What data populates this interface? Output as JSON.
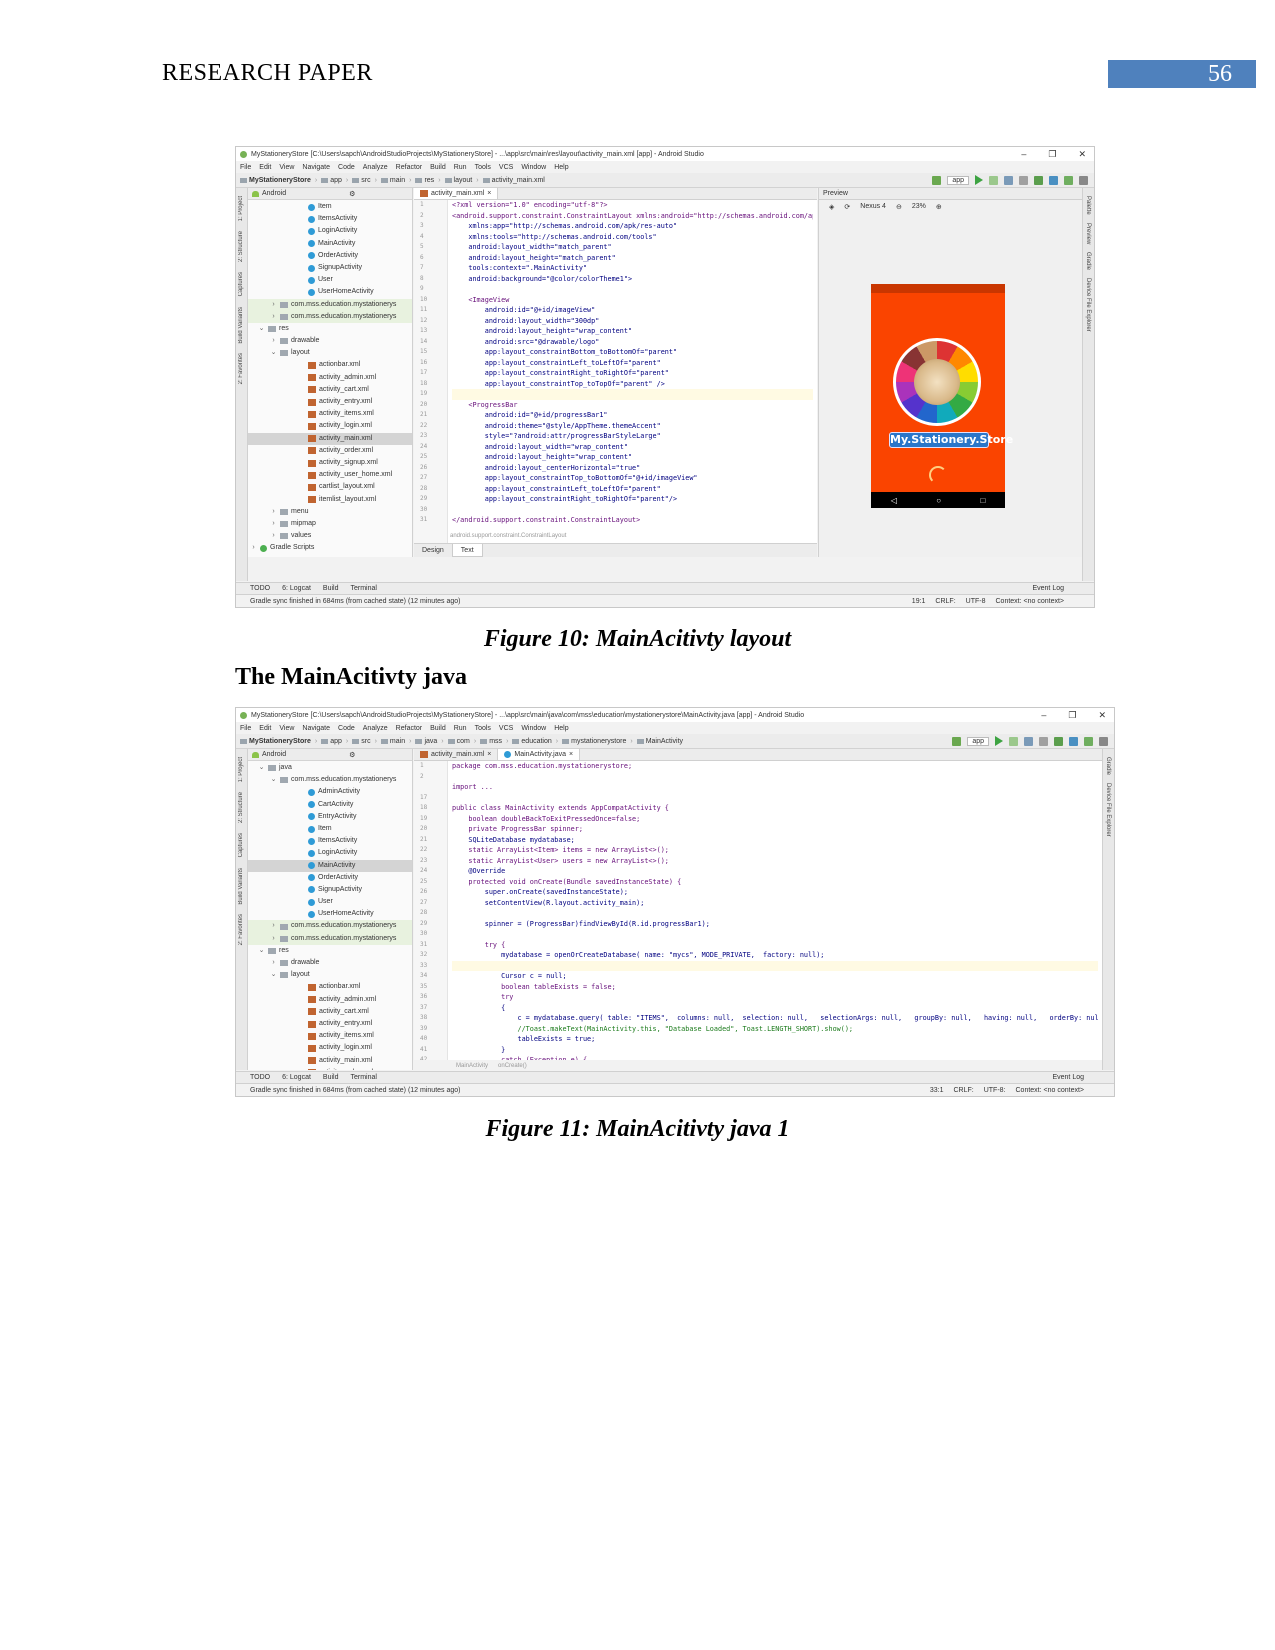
{
  "header": {
    "running_head": "RESEARCH PAPER",
    "page_number": "56"
  },
  "figure10": {
    "title": "MyStationeryStore [C:\\Users\\sapch\\AndroidStudioProjects\\MyStationeryStore] - ...\\app\\src\\main\\res\\layout\\activity_main.xml [app] - Android Studio",
    "menu": [
      "File",
      "Edit",
      "View",
      "Navigate",
      "Code",
      "Analyze",
      "Refactor",
      "Build",
      "Run",
      "Tools",
      "VCS",
      "Window",
      "Help"
    ],
    "breadcrumbs": [
      "MyStationeryStore",
      "app",
      "src",
      "main",
      "res",
      "layout",
      "activity_main.xml"
    ],
    "run_config": "app",
    "pane_mode": "Android",
    "tab": "activity_main.xml",
    "preview_label": "Preview",
    "device": "Nexus 4",
    "zoom": "23%",
    "left_strip": [
      "1: Project",
      "2: Structure",
      "Captures",
      "Build Variants",
      "2: Favorites"
    ],
    "right_strip": [
      "Palette",
      "Preview",
      "Gradle",
      "Device File Explorer"
    ],
    "tree": [
      {
        "label": "Item",
        "kind": "class"
      },
      {
        "label": "ItemsActivity",
        "kind": "class"
      },
      {
        "label": "LoginActivity",
        "kind": "class"
      },
      {
        "label": "MainActivity",
        "kind": "class"
      },
      {
        "label": "OrderActivity",
        "kind": "class"
      },
      {
        "label": "SignupActivity",
        "kind": "class"
      },
      {
        "label": "User",
        "kind": "class"
      },
      {
        "label": "UserHomeActivity",
        "kind": "class"
      },
      {
        "label": "com.mss.education.mystationerys",
        "kind": "pkg"
      },
      {
        "label": "com.mss.education.mystationerys",
        "kind": "pkg"
      },
      {
        "label": "res",
        "kind": "dir"
      },
      {
        "label": "drawable",
        "kind": "dir"
      },
      {
        "label": "layout",
        "kind": "dir"
      },
      {
        "label": "actionbar.xml",
        "kind": "xml"
      },
      {
        "label": "activity_admin.xml",
        "kind": "xml"
      },
      {
        "label": "activity_cart.xml",
        "kind": "xml"
      },
      {
        "label": "activity_entry.xml",
        "kind": "xml"
      },
      {
        "label": "activity_items.xml",
        "kind": "xml"
      },
      {
        "label": "activity_login.xml",
        "kind": "xml"
      },
      {
        "label": "activity_main.xml",
        "kind": "xml"
      },
      {
        "label": "activity_order.xml",
        "kind": "xml"
      },
      {
        "label": "activity_signup.xml",
        "kind": "xml"
      },
      {
        "label": "activity_user_home.xml",
        "kind": "xml"
      },
      {
        "label": "cartlist_layout.xml",
        "kind": "xml"
      },
      {
        "label": "itemlist_layout.xml",
        "kind": "xml"
      },
      {
        "label": "menu",
        "kind": "dir"
      },
      {
        "label": "mipmap",
        "kind": "dir"
      },
      {
        "label": "values",
        "kind": "dir"
      },
      {
        "label": "Gradle Scripts",
        "kind": "gradle"
      }
    ],
    "line_numbers": [
      "1",
      "2",
      "3",
      "4",
      "5",
      "6",
      "7",
      "8",
      "9",
      "10",
      "11",
      "12",
      "13",
      "14",
      "15",
      "16",
      "17",
      "18",
      "19",
      "20",
      "21",
      "22",
      "23",
      "24",
      "25",
      "26",
      "27",
      "28",
      "29",
      "30",
      "31"
    ],
    "code": [
      "<?xml version=\"1.0\" encoding=\"utf-8\"?>",
      "<android.support.constraint.ConstraintLayout xmlns:android=\"http://schemas.android.com/ap",
      "    xmlns:app=\"http://schemas.android.com/apk/res-auto\"",
      "    xmlns:tools=\"http://schemas.android.com/tools\"",
      "    android:layout_width=\"match_parent\"",
      "    android:layout_height=\"match_parent\"",
      "    tools:context=\".MainActivity\"",
      "    android:background=\"@color/colorTheme1\">",
      "",
      "    <ImageView",
      "        android:id=\"@+id/imageView\"",
      "        android:layout_width=\"300dp\"",
      "        android:layout_height=\"wrap_content\"",
      "        android:src=\"@drawable/logo\"",
      "        app:layout_constraintBottom_toBottomOf=\"parent\"",
      "        app:layout_constraintLeft_toLeftOf=\"parent\"",
      "        app:layout_constraintRight_toRightOf=\"parent\"",
      "        app:layout_constraintTop_toTopOf=\"parent\" />",
      "",
      "    <ProgressBar",
      "        android:id=\"@+id/progressBar1\"",
      "        android:theme=\"@style/AppTheme.themeAccent\"",
      "        style=\"?android:attr/progressBarStyleLarge\"",
      "        android:layout_width=\"wrap_content\"",
      "        android:layout_height=\"wrap_content\"",
      "        android:layout_centerHorizontal=\"true\"",
      "        app:layout_constraintTop_toBottomOf=\"@+id/imageView\"",
      "        app:layout_constraintLeft_toLeftOf=\"parent\"",
      "        app:layout_constraintRight_toRightOf=\"parent\"/>",
      "",
      "</android.support.constraint.ConstraintLayout>"
    ],
    "code_breadcrumb": "android.support.constraint.ConstraintLayout",
    "design_tab": "Design",
    "text_tab": "Text",
    "phone_banner": "My.Stationery.Store",
    "bottom_tools": [
      "TODO",
      "6: Logcat",
      "Build",
      "Terminal"
    ],
    "event_log": "Event Log",
    "status": "Gradle sync finished in 684ms (from cached state) (12 minutes ago)",
    "status_right": [
      "19:1",
      "CRLF:",
      "UTF-8",
      "Context: <no context>"
    ],
    "caption": "Figure 10: MainAcitivty layout"
  },
  "section_heading": "The MainAcitivty java",
  "figure11": {
    "title": "MyStationeryStore [C:\\Users\\sapch\\AndroidStudioProjects\\MyStationeryStore] - ...\\app\\src\\main\\java\\com\\mss\\education\\mystationerystore\\MainActivity.java [app] - Android Studio",
    "menu": [
      "File",
      "Edit",
      "View",
      "Navigate",
      "Code",
      "Analyze",
      "Refactor",
      "Build",
      "Run",
      "Tools",
      "VCS",
      "Window",
      "Help"
    ],
    "breadcrumbs": [
      "MyStationeryStore",
      "app",
      "src",
      "main",
      "java",
      "com",
      "mss",
      "education",
      "mystationerystore",
      "MainActivity"
    ],
    "run_config": "app",
    "pane_mode": "Android",
    "tabs": [
      "activity_main.xml",
      "MainActivity.java"
    ],
    "left_strip": [
      "1: Project",
      "2: Structure",
      "Captures",
      "Build Variants",
      "2: Favorites"
    ],
    "right_strip": [
      "Gradle",
      "Device File Explorer"
    ],
    "tree": [
      {
        "label": "java",
        "kind": "dir"
      },
      {
        "label": "com.mss.education.mystationerys",
        "kind": "pkgdir"
      },
      {
        "label": "AdminActivity",
        "kind": "class"
      },
      {
        "label": "CartActivity",
        "kind": "class"
      },
      {
        "label": "EntryActivity",
        "kind": "class"
      },
      {
        "label": "Item",
        "kind": "class"
      },
      {
        "label": "ItemsActivity",
        "kind": "class"
      },
      {
        "label": "LoginActivity",
        "kind": "class"
      },
      {
        "label": "MainActivity",
        "kind": "class"
      },
      {
        "label": "OrderActivity",
        "kind": "class"
      },
      {
        "label": "SignupActivity",
        "kind": "class"
      },
      {
        "label": "User",
        "kind": "class"
      },
      {
        "label": "UserHomeActivity",
        "kind": "class"
      },
      {
        "label": "com.mss.education.mystationerys",
        "kind": "pkg"
      },
      {
        "label": "com.mss.education.mystationerys",
        "kind": "pkg"
      },
      {
        "label": "res",
        "kind": "dir"
      },
      {
        "label": "drawable",
        "kind": "dir"
      },
      {
        "label": "layout",
        "kind": "dir"
      },
      {
        "label": "actionbar.xml",
        "kind": "xml"
      },
      {
        "label": "activity_admin.xml",
        "kind": "xml"
      },
      {
        "label": "activity_cart.xml",
        "kind": "xml"
      },
      {
        "label": "activity_entry.xml",
        "kind": "xml"
      },
      {
        "label": "activity_items.xml",
        "kind": "xml"
      },
      {
        "label": "activity_login.xml",
        "kind": "xml"
      },
      {
        "label": "activity_main.xml",
        "kind": "xml"
      },
      {
        "label": "activity_order.xml",
        "kind": "xml"
      },
      {
        "label": "activity_signup.xml",
        "kind": "xml"
      },
      {
        "label": "activity_user_home.xml",
        "kind": "xml"
      },
      {
        "label": "cartlist_layout.xml",
        "kind": "xml"
      }
    ],
    "line_numbers": [
      "1",
      "2",
      "",
      "17",
      "18",
      "19",
      "20",
      "21",
      "22",
      "23",
      "24",
      "25",
      "26",
      "27",
      "28",
      "29",
      "30",
      "31",
      "32",
      "33",
      "34",
      "35",
      "36",
      "37",
      "38",
      "39",
      "40",
      "41",
      "42",
      "43",
      "44",
      "45",
      "46"
    ],
    "code": [
      "package com.mss.education.mystationerystore;",
      "",
      "import ...",
      "",
      "public class MainActivity extends AppCompatActivity {",
      "    boolean doubleBackToExitPressedOnce=false;",
      "    private ProgressBar spinner;",
      "    SQLiteDatabase mydatabase;",
      "    static ArrayList<Item> items = new ArrayList<>();",
      "    static ArrayList<User> users = new ArrayList<>();",
      "    @Override",
      "    protected void onCreate(Bundle savedInstanceState) {",
      "        super.onCreate(savedInstanceState);",
      "        setContentView(R.layout.activity_main);",
      "",
      "        spinner = (ProgressBar)findViewById(R.id.progressBar1);",
      "",
      "        try {",
      "            mydatabase = openOrCreateDatabase( name: \"mycs\", MODE_PRIVATE,  factory: null);",
      "",
      "            Cursor c = null;",
      "            boolean tableExists = false;",
      "            try",
      "            {",
      "                c = mydatabase.query( table: \"ITEMS\",  columns: null,  selection: null,   selectionArgs: null,   groupBy: null,   having: null,   orderBy: null);",
      "                //Toast.makeText(MainActivity.this, \"Database Loaded\", Toast.LENGTH_SHORT).show();",
      "                tableExists = true;",
      "            }",
      "            catch (Exception e) {",
      "                mydatabase.execSQL(\"CREATE TABLE IF NOT EXISTS ITEMS(ITEM_ID INTEGER PRIMARY KEY AUTOINCREMENT, CATEGORY VARCHAR(20) NOT NULL,",
      "                try {",
      "                    mydatabase.execSQL(  sql: \"INSERT INTO ITEMS (CATEGORY,ITEM_NAME,DESCRIPTION,IMAGE_URL,PRICE,STOCK) VALUES(?,?,?,?,?,?)\",",
      "                    mydatabase.execSQL(  sql: \"INSERT INTO ITEMS (CATEGORY,ITEM_NAME,DESCRIPTION,IMAGE_URL,PRICE,STOCK) VALUES(?,?,?,?,?,?)\","
    ],
    "code_breadcrumb": [
      "MainActivity",
      "onCreate()"
    ],
    "bottom_tools": [
      "TODO",
      "6: Logcat",
      "Build",
      "Terminal"
    ],
    "event_log": "Event Log",
    "status": "Gradle sync finished in 684ms (from cached state) (12 minutes ago)",
    "status_right": [
      "33:1",
      "CRLF:",
      "UTF-8:",
      "Context: <no context>"
    ],
    "caption": "Figure 11: MainAcitivty java 1"
  }
}
